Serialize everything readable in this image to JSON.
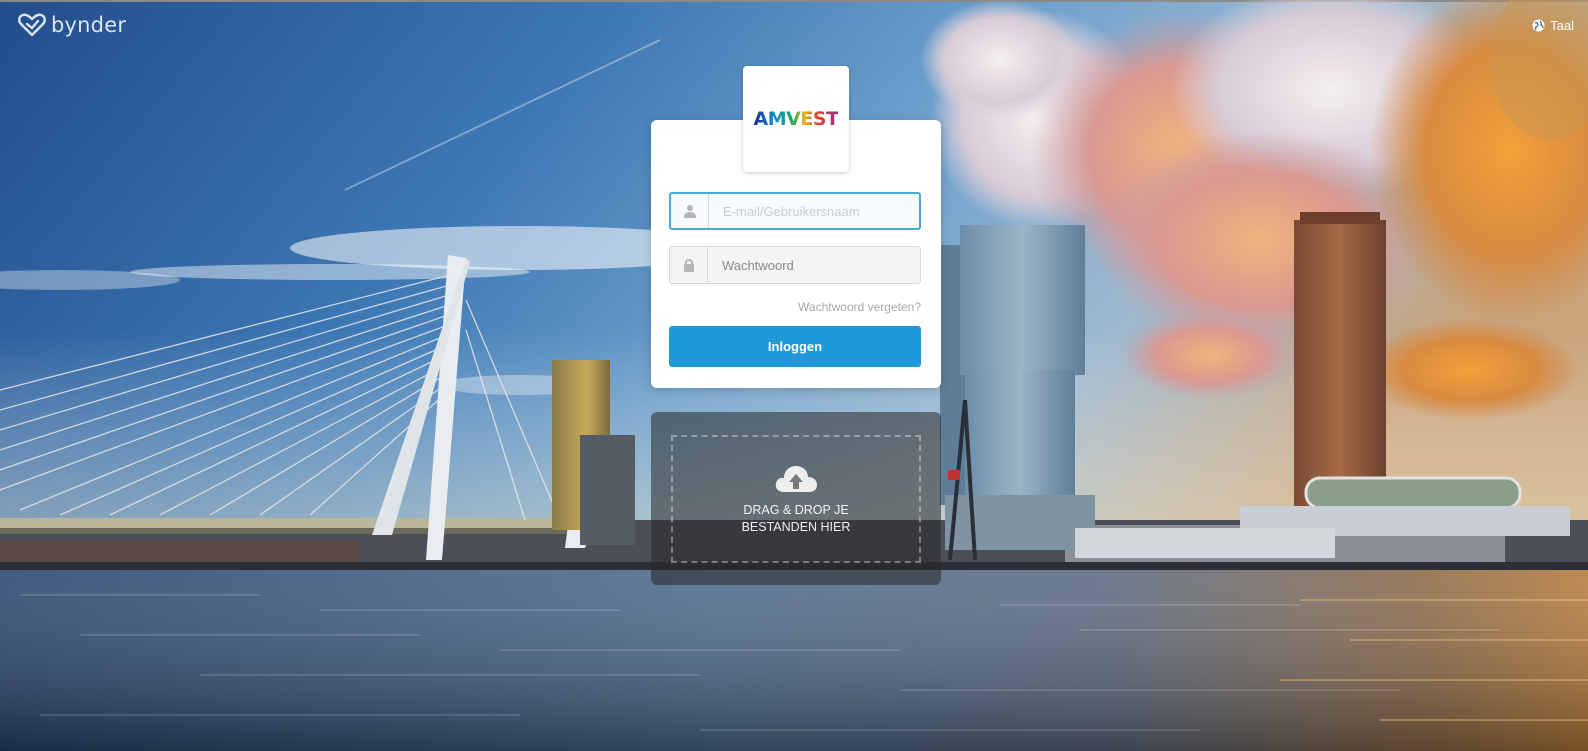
{
  "header": {
    "brand_name": "bynder",
    "language_label": "Taal"
  },
  "login": {
    "logo_text": "AMVEST",
    "email_placeholder": "E-mail/Gebruikersnaam",
    "password_placeholder": "Wachtwoord",
    "forgot_password_label": "Wachtwoord vergeten?",
    "login_button_label": "Inloggen"
  },
  "dropzone": {
    "label": "DRAG & DROP JE BESTANDEN HIER"
  },
  "colors": {
    "accent": "#1f9ad8",
    "input_focus_border": "#4aa7d8"
  },
  "icons": {
    "brand": "bynder-logo-icon",
    "language": "globe-icon",
    "email": "user-icon",
    "password": "lock-icon",
    "dropzone": "cloud-upload-icon"
  }
}
